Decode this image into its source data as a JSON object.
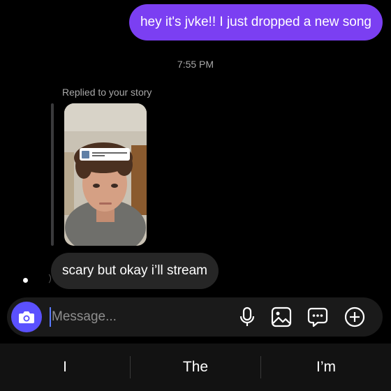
{
  "thread": {
    "sent_message": "hey it's jvke!! I just dropped a new song",
    "timestamp": "7:55 PM",
    "reply_label": "Replied to your story",
    "received_message": "scary but okay i’ll stream"
  },
  "composer": {
    "placeholder": "Message..."
  },
  "icons": {
    "camera": "camera-icon",
    "mic": "microphone-icon",
    "gallery": "image-icon",
    "sticker": "chat-bubble-icon",
    "add": "plus-circle-icon"
  },
  "keyboard": {
    "suggestions": [
      "I",
      "The",
      "I’m"
    ]
  },
  "colors": {
    "sent_bubble": "#7b3ff2",
    "received_bubble": "#262626",
    "camera_button": "#5b51ff",
    "background": "#000000"
  }
}
